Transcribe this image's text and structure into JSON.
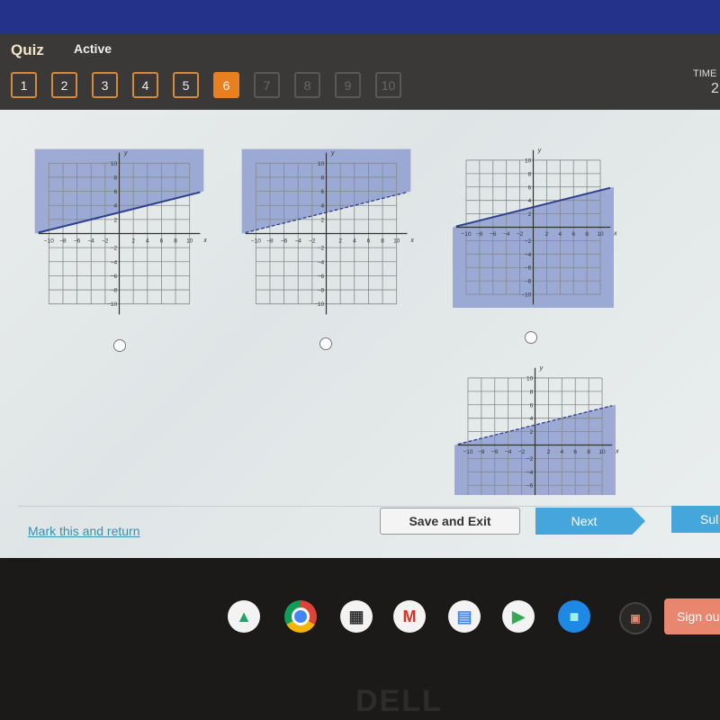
{
  "header": {
    "title": "Quiz",
    "status": "Active",
    "timer_label": "TIME",
    "timer_value": "2"
  },
  "questions": [
    {
      "n": "1",
      "state": "answered"
    },
    {
      "n": "2",
      "state": "answered"
    },
    {
      "n": "3",
      "state": "answered"
    },
    {
      "n": "4",
      "state": "answered"
    },
    {
      "n": "5",
      "state": "answered"
    },
    {
      "n": "6",
      "state": "current"
    },
    {
      "n": "7",
      "state": "locked"
    },
    {
      "n": "8",
      "state": "locked"
    },
    {
      "n": "9",
      "state": "locked"
    },
    {
      "n": "10",
      "state": "locked"
    }
  ],
  "colors": {
    "accent": "#e8801f",
    "shade": "#8e9fd0",
    "line": "#2d3f8f",
    "button": "#45a6dc"
  },
  "chart_data": [
    {
      "type": "line",
      "xlabel": "x",
      "ylabel": "y",
      "xlim": [
        -10,
        10
      ],
      "ylim": [
        -10,
        10
      ],
      "ticks": [
        -10,
        -8,
        -6,
        -4,
        -2,
        2,
        4,
        6,
        8,
        10
      ],
      "slope": 0.25,
      "intercept": 3,
      "boundary": "solid",
      "shade": "above"
    },
    {
      "type": "line",
      "xlabel": "x",
      "ylabel": "y",
      "xlim": [
        -10,
        10
      ],
      "ylim": [
        -10,
        10
      ],
      "ticks": [
        -10,
        -8,
        -6,
        -4,
        -2,
        2,
        4,
        6,
        8,
        10
      ],
      "slope": 0.25,
      "intercept": 3,
      "boundary": "dashed",
      "shade": "above"
    },
    {
      "type": "line",
      "xlabel": "x",
      "ylabel": "y",
      "xlim": [
        -10,
        10
      ],
      "ylim": [
        -10,
        10
      ],
      "ticks": [
        -10,
        -8,
        -6,
        -4,
        -2,
        2,
        4,
        6,
        8,
        10
      ],
      "slope": 0.25,
      "intercept": 3,
      "boundary": "solid",
      "shade": "below"
    },
    {
      "type": "line",
      "xlabel": "x",
      "ylabel": "y",
      "xlim": [
        -10,
        10
      ],
      "ylim": [
        -10,
        10
      ],
      "ticks": [
        -10,
        -8,
        -6,
        -4,
        -2,
        2,
        4,
        6,
        8,
        10
      ],
      "slope": 0.25,
      "intercept": 3,
      "boundary": "dashed",
      "shade": "below"
    }
  ],
  "footer": {
    "mark_label": "Mark this and return",
    "save_label": "Save and Exit",
    "next_label": "Next",
    "submit_label": "Sul"
  },
  "taskbar": {
    "apps": [
      "google-drive-icon",
      "chrome-icon",
      "calculator-icon",
      "gmail-icon",
      "google-docs-icon",
      "play-store-icon",
      "files-icon"
    ],
    "signout_label": "Sign ou"
  },
  "bezel_logo": "DELL"
}
